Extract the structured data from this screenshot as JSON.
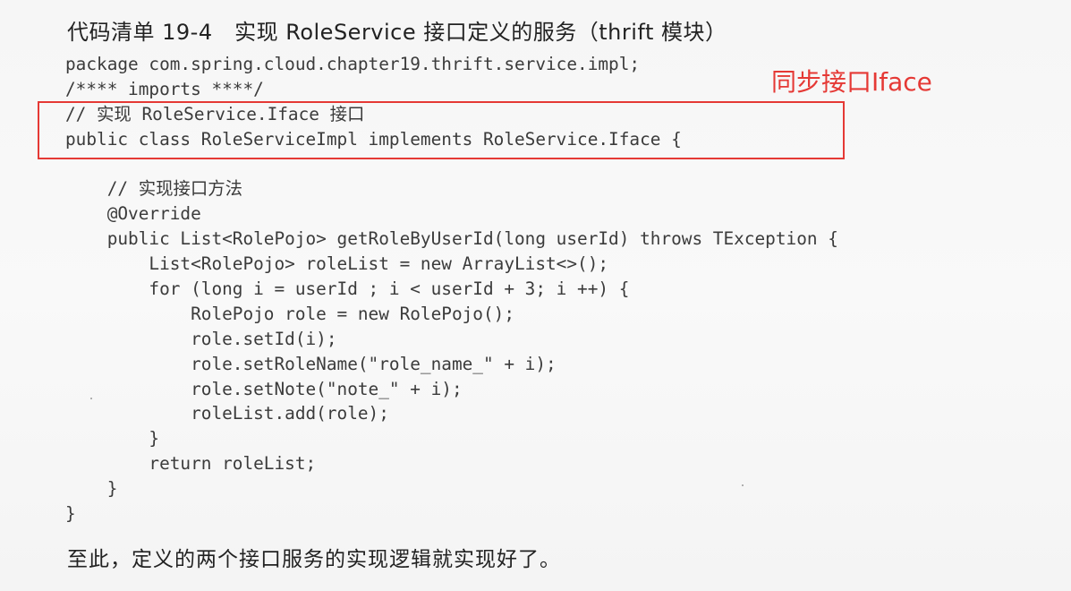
{
  "listing": {
    "title": "代码清单 19-4　实现 RoleService 接口定义的服务（thrift 模块）"
  },
  "annotation": {
    "label": "同步接口Iface",
    "color": "#e53935"
  },
  "code_lines": [
    "package com.spring.cloud.chapter19.thrift.service.impl;",
    "/**** imports ****/",
    "// 实现 RoleService.Iface 接口",
    "public class RoleServiceImpl implements RoleService.Iface {",
    "",
    "    // 实现接口方法",
    "    @Override",
    "    public List<RolePojo> getRoleByUserId(long userId) throws TException {",
    "        List<RolePojo> roleList = new ArrayList<>();",
    "        for (long i = userId ; i < userId + 3; i ++) {",
    "            RolePojo role = new RolePojo();",
    "            role.setId(i);",
    "            role.setRoleName(\"role_name_\" + i);",
    "            role.setNote(\"note_\" + i);",
    "            roleList.add(role);",
    "        }",
    "        return roleList;",
    "    }",
    "}"
  ],
  "closing": {
    "text": "至此，定义的两个接口服务的实现逻辑就实现好了。"
  }
}
